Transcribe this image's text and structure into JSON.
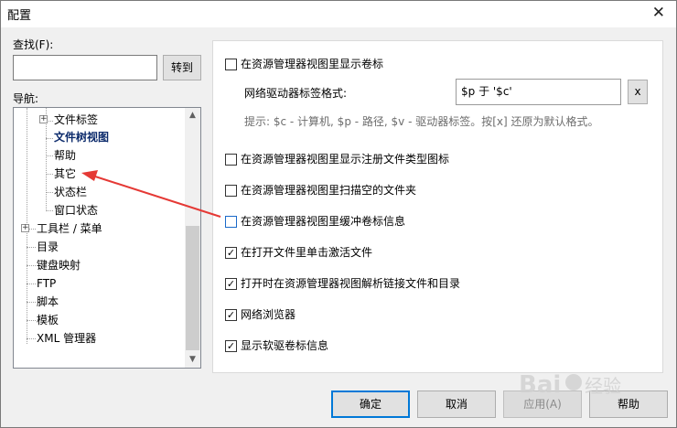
{
  "window": {
    "title": "配置",
    "close_glyph": "✕"
  },
  "find": {
    "label": "查找(F):",
    "value": "",
    "goto_button": "转到"
  },
  "nav": {
    "label": "导航:",
    "items": [
      {
        "label": "文件标签",
        "level": 1,
        "expandable": true,
        "selected": false
      },
      {
        "label": "文件树视图",
        "level": 1,
        "expandable": false,
        "selected": true
      },
      {
        "label": "帮助",
        "level": 1,
        "expandable": false,
        "selected": false
      },
      {
        "label": "其它",
        "level": 1,
        "expandable": false,
        "selected": false
      },
      {
        "label": "状态栏",
        "level": 1,
        "expandable": false,
        "selected": false
      },
      {
        "label": "窗口状态",
        "level": 1,
        "expandable": false,
        "selected": false
      },
      {
        "label": "工具栏 / 菜单",
        "level": 0,
        "expandable": true,
        "selected": false
      },
      {
        "label": "目录",
        "level": 0,
        "expandable": false,
        "selected": false
      },
      {
        "label": "键盘映射",
        "level": 0,
        "expandable": false,
        "selected": false
      },
      {
        "label": "FTP",
        "level": 0,
        "expandable": false,
        "selected": false
      },
      {
        "label": "脚本",
        "level": 0,
        "expandable": false,
        "selected": false
      },
      {
        "label": "模板",
        "level": 0,
        "expandable": false,
        "selected": false
      },
      {
        "label": "XML 管理器",
        "level": 0,
        "expandable": false,
        "selected": false
      }
    ]
  },
  "options": {
    "show_volume_label": {
      "label": "在资源管理器视图里显示卷标",
      "checked": false
    },
    "drive_label_format_label": "网络驱动器标签格式:",
    "drive_label_format_value": "$p 于 '$c'",
    "clear_button": "x",
    "hint": "提示: $c - 计算机, $p - 路径, $v - 驱动器标签。按[x] 还原为默认格式。",
    "checkboxes": [
      {
        "label": "在资源管理器视图里显示注册文件类型图标",
        "checked": false
      },
      {
        "label": "在资源管理器视图里扫描空的文件夹",
        "checked": false
      },
      {
        "label": "在资源管理器视图里缓冲卷标信息",
        "checked": false
      },
      {
        "label": "在打开文件里单击激活文件",
        "checked": true
      },
      {
        "label": "打开时在资源管理器视图解析链接文件和目录",
        "checked": true
      },
      {
        "label": "网络浏览器",
        "checked": true
      },
      {
        "label": "显示软驱卷标信息",
        "checked": true
      }
    ]
  },
  "buttons": {
    "ok": "确定",
    "cancel": "取消",
    "apply": "应用(A)",
    "help": "帮助"
  },
  "colors": {
    "annotation_arrow": "#e53935",
    "focus_blue": "#0078d7"
  },
  "watermark": {
    "text": "Baidu 经验"
  }
}
